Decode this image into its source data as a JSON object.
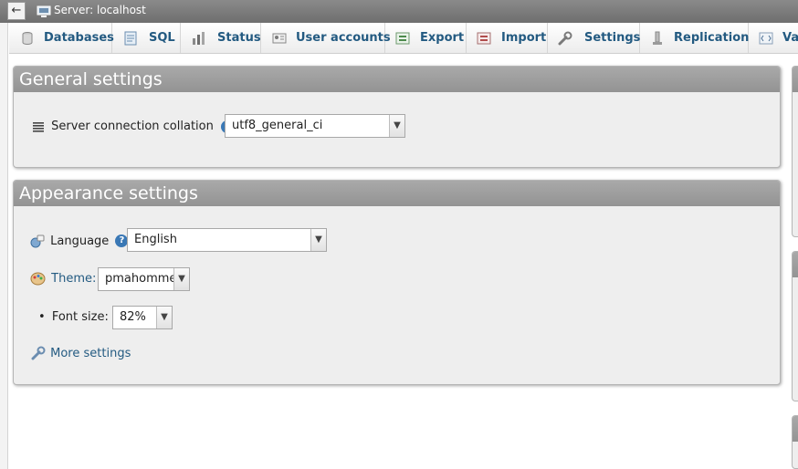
{
  "topbar": {
    "back_label": "←",
    "server_title": "Server: localhost"
  },
  "tabs": [
    {
      "label": "Databases",
      "icon": "database-icon"
    },
    {
      "label": "SQL",
      "icon": "sql-icon"
    },
    {
      "label": "Status",
      "icon": "status-icon"
    },
    {
      "label": "User accounts",
      "icon": "user-accounts-icon"
    },
    {
      "label": "Export",
      "icon": "export-icon"
    },
    {
      "label": "Import",
      "icon": "import-icon"
    },
    {
      "label": "Settings",
      "icon": "settings-icon"
    },
    {
      "label": "Replication",
      "icon": "replication-icon"
    },
    {
      "label": "Va",
      "icon": "variables-icon"
    }
  ],
  "general": {
    "title": "General settings",
    "collation_label": "Server connection collation",
    "help": "?",
    "colon": ":",
    "collation_value": "utf8_general_ci"
  },
  "appearance": {
    "title": "Appearance settings",
    "language_label": "Language",
    "language_value": "English",
    "theme_label": "Theme:",
    "theme_value": "pmahomme",
    "font_size_label": "Font size:",
    "font_size_value": "82%",
    "more_settings": "More settings",
    "bullet": "•"
  },
  "colors": {
    "link": "#235a81",
    "panel_header": "#9e9e9e",
    "topbar": "#7a7a7a"
  }
}
